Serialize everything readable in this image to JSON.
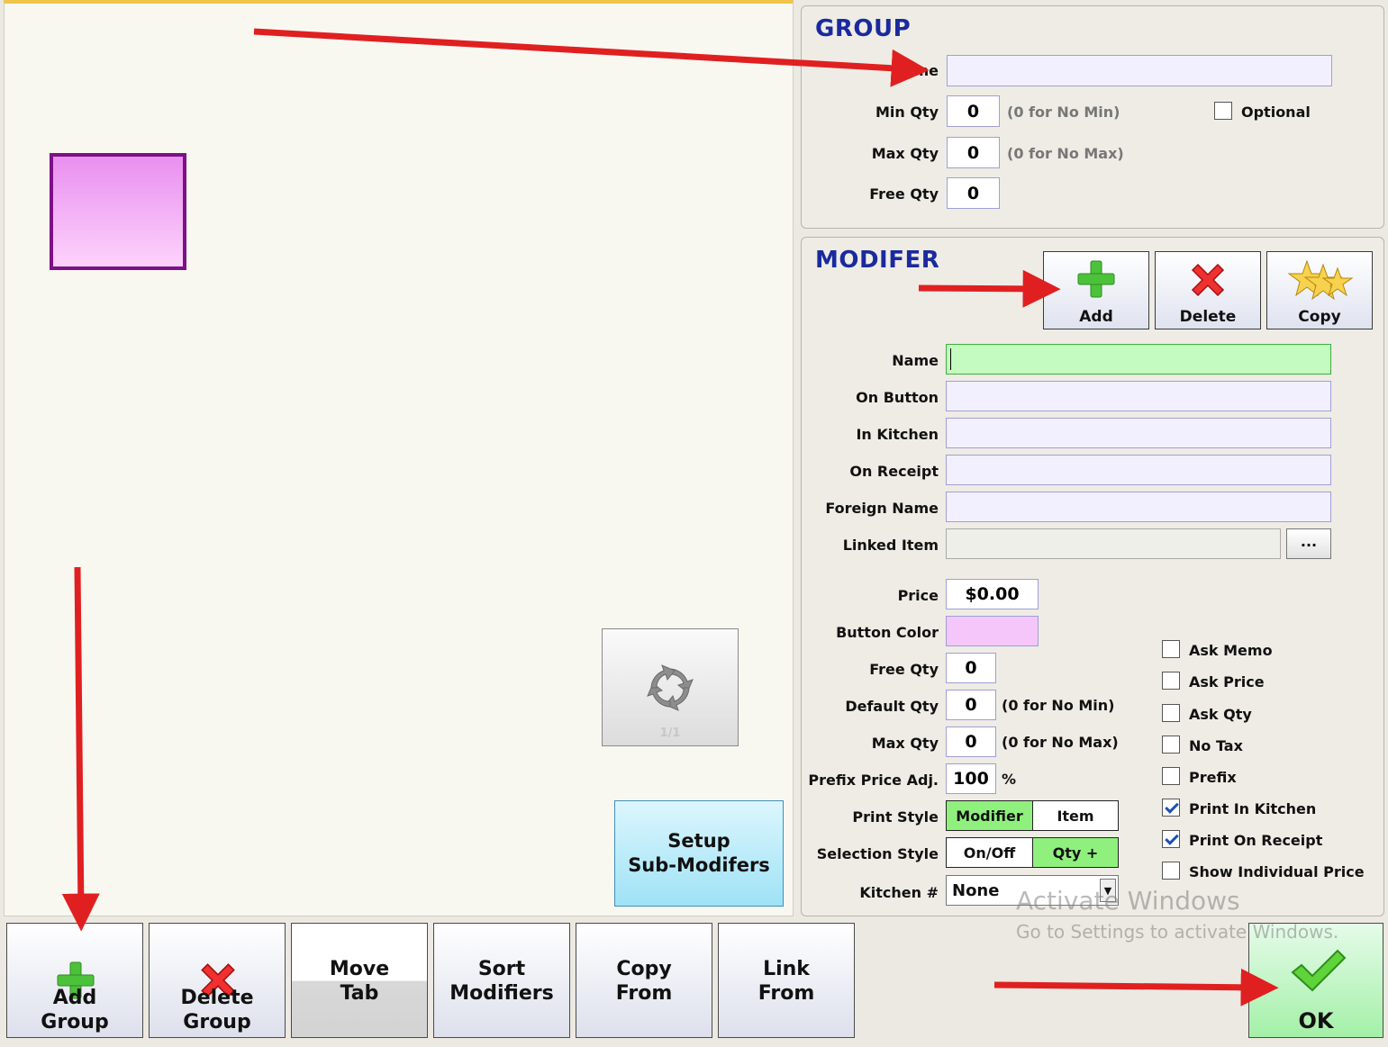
{
  "group": {
    "title": "GROUP",
    "name_label": "Name",
    "name_value": "",
    "min_qty_label": "Min Qty",
    "min_qty": "0",
    "min_qty_hint": "(0 for No Min)",
    "max_qty_label": "Max Qty",
    "max_qty": "0",
    "max_qty_hint": "(0 for No Max)",
    "free_qty_label": "Free Qty",
    "free_qty": "0",
    "optional_label": "Optional",
    "optional_checked": false
  },
  "modifier": {
    "title": "MODIFER",
    "add_label": "Add",
    "delete_label": "Delete",
    "copy_label": "Copy",
    "name_label": "Name",
    "on_button_label": "On Button",
    "in_kitchen_label": "In Kitchen",
    "on_receipt_label": "On Receipt",
    "foreign_name_label": "Foreign Name",
    "linked_item_label": "Linked Item",
    "browse_label": "...",
    "price_label": "Price",
    "price_value": "$0.00",
    "button_color_label": "Button Color",
    "button_color": "#f5c6fa",
    "free_qty_label": "Free Qty",
    "free_qty": "0",
    "default_qty_label": "Default Qty",
    "default_qty": "0",
    "default_qty_hint": "(0 for No Min)",
    "max_qty_label": "Max Qty",
    "max_qty": "0",
    "max_qty_hint": "(0 for No Max)",
    "prefix_price_label": "Prefix Price Adj.",
    "prefix_price_value": "100",
    "prefix_price_unit": "%",
    "print_style_label": "Print Style",
    "print_style_options": [
      "Modifier",
      "Item"
    ],
    "print_style_selected": "Modifier",
    "selection_style_label": "Selection Style",
    "selection_style_options": [
      "On/Off",
      "Qty +"
    ],
    "selection_style_selected": "Qty +",
    "kitchen_label": "Kitchen #",
    "kitchen_value": "None",
    "options": [
      {
        "label": "Ask Memo",
        "checked": false
      },
      {
        "label": "Ask Price",
        "checked": false
      },
      {
        "label": "Ask Qty",
        "checked": false
      },
      {
        "label": "No Tax",
        "checked": false
      },
      {
        "label": "Prefix",
        "checked": false
      },
      {
        "label": "Print In Kitchen",
        "checked": true
      },
      {
        "label": "Print On Receipt",
        "checked": true
      },
      {
        "label": "Show Individual Price",
        "checked": false
      }
    ]
  },
  "canvas": {
    "pager_count": "1/1",
    "setup_label": "Setup\nSub-Modifers",
    "tile_color": "#ef9cf3"
  },
  "bottom": {
    "add_group": "Add\nGroup",
    "delete_group": "Delete\nGroup",
    "move_tab": "Move\nTab",
    "sort_modifiers": "Sort\nModifiers",
    "copy_from": "Copy\nFrom",
    "link_from": "Link\nFrom",
    "ok": "OK"
  },
  "watermark": {
    "line1": "Activate Windows",
    "line2": "Go to Settings to activate Windows."
  },
  "annotation_color": "#e02020"
}
